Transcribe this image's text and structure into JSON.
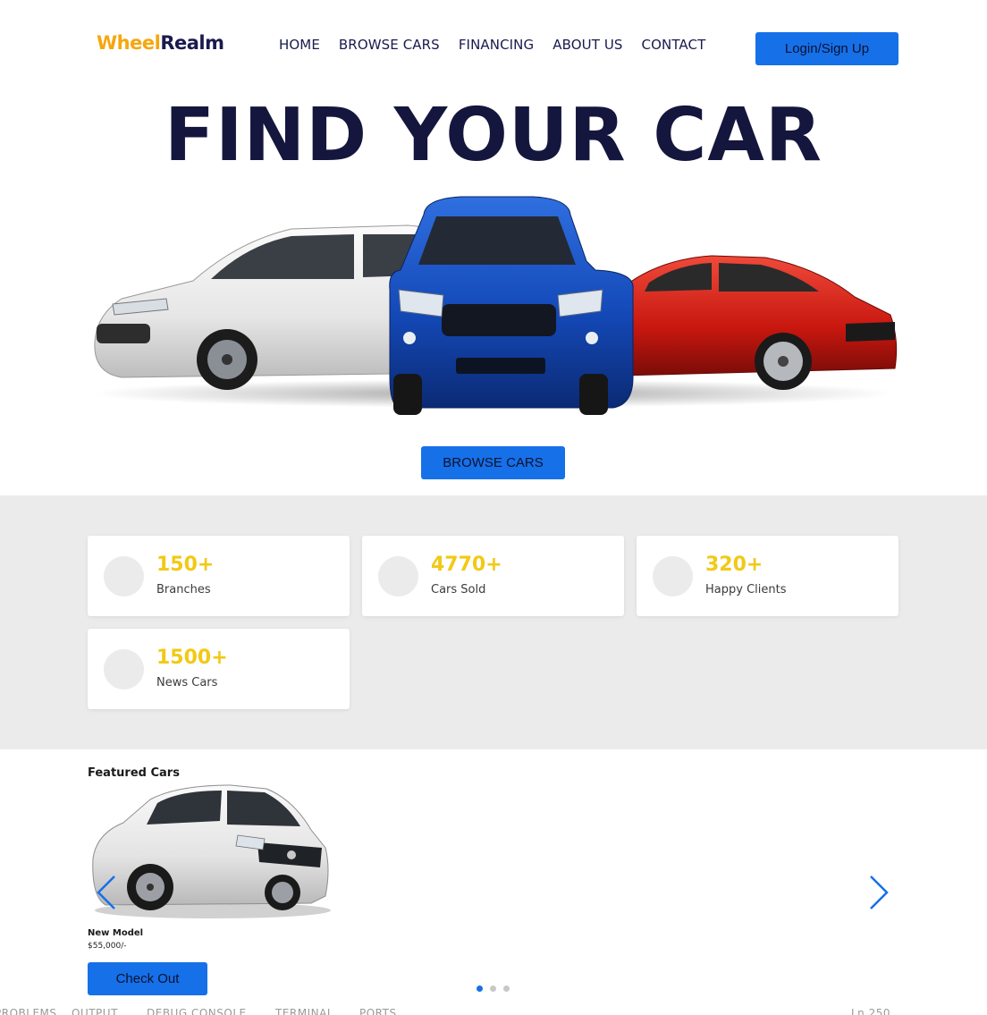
{
  "header": {
    "logo_part1": "Wheel",
    "logo_part2": "Realm",
    "nav": [
      "HOME",
      "BROWSE CARS",
      "FINANCING",
      "ABOUT US",
      "CONTACT"
    ],
    "login_label": "Login/Sign Up"
  },
  "hero": {
    "title": "FIND YOUR CAR",
    "browse_label": "BROWSE CARS"
  },
  "stats": [
    {
      "value": "150+",
      "label": "Branches"
    },
    {
      "value": "4770+",
      "label": "Cars Sold"
    },
    {
      "value": "320+",
      "label": "Happy Clients"
    },
    {
      "value": "1500+",
      "label": "News Cars"
    }
  ],
  "featured": {
    "title": "Featured Cars",
    "car_name": "New Model",
    "car_price": "$55,000/-",
    "checkout_label": "Check Out",
    "slide_count": 3,
    "active_slide": 1
  },
  "bottom_bar": {
    "tabs": [
      "PROBLEMS",
      "OUTPUT",
      "DEBUG CONSOLE",
      "TERMINAL",
      "PORTS"
    ],
    "status": "Ln 250"
  },
  "colors": {
    "accent_blue": "#1670e8",
    "logo_orange": "#f5a70f",
    "stat_yellow": "#f2c915",
    "title_navy": "#15163e",
    "stats_bg": "#ebebeb"
  }
}
